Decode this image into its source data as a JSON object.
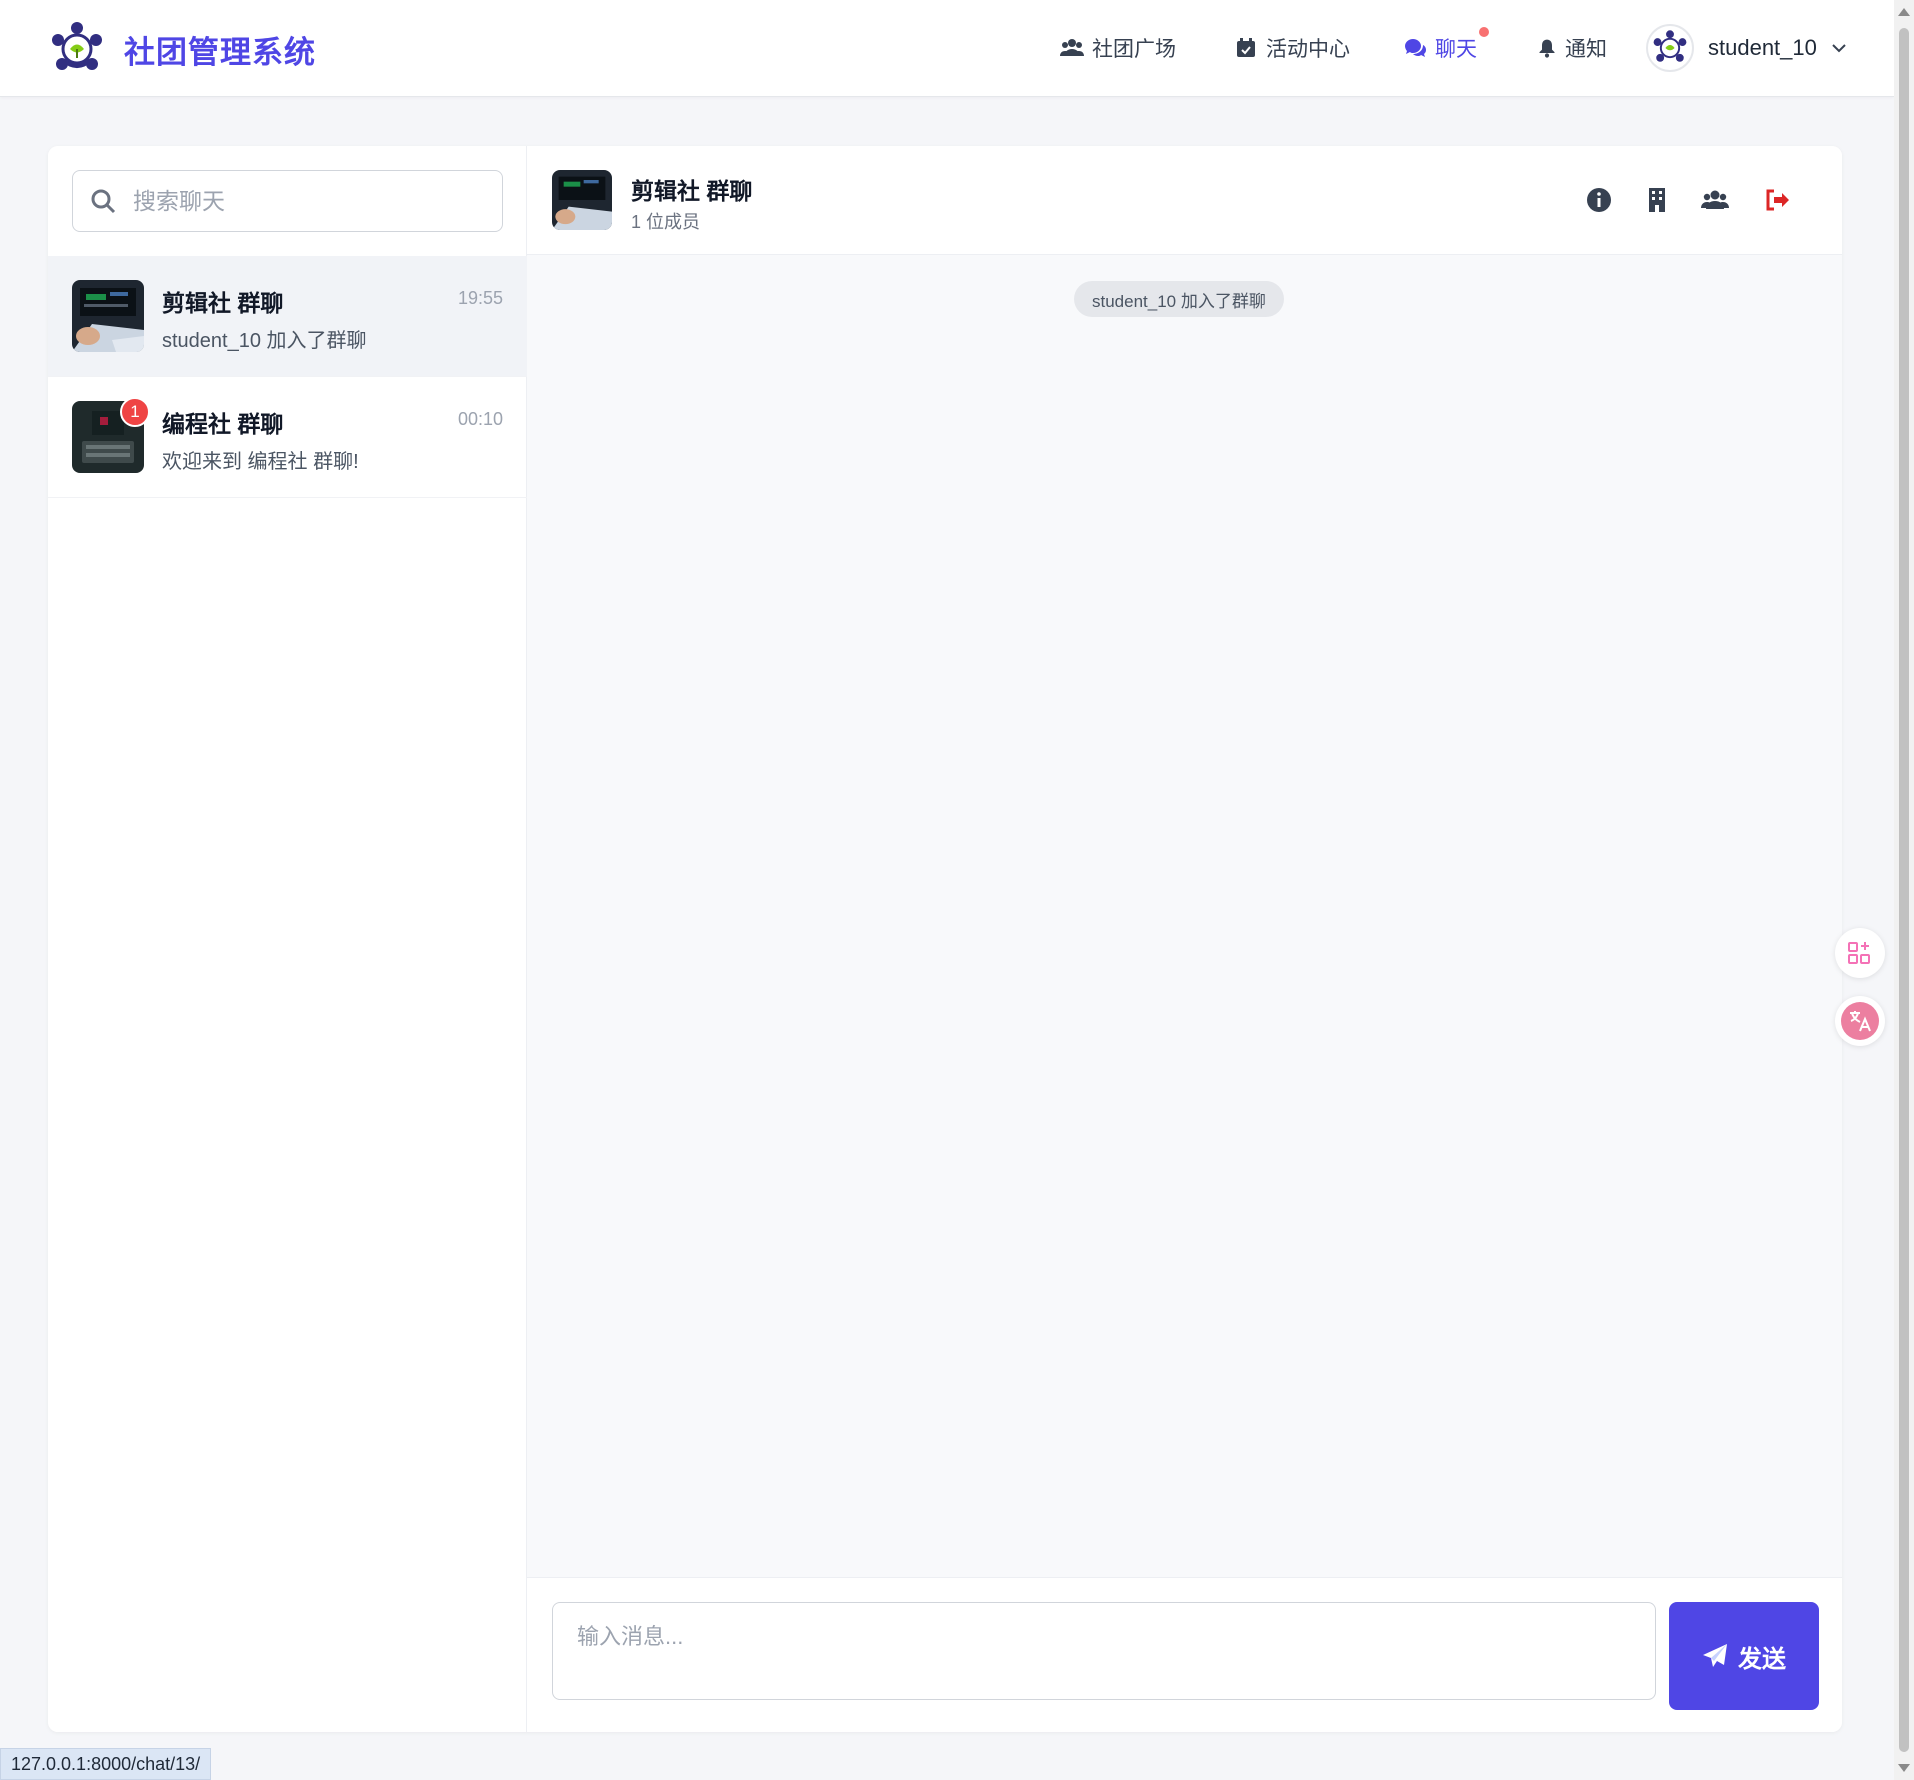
{
  "app": {
    "title": "社团管理系统",
    "logo_icon": "club-logo-icon"
  },
  "nav": {
    "items": [
      {
        "label": "社团广场",
        "icon": "users-icon"
      },
      {
        "label": "活动中心",
        "icon": "calendar-check-icon"
      },
      {
        "label": "聊天",
        "icon": "comments-icon",
        "active": true,
        "has_dot": true
      },
      {
        "label": "通知",
        "icon": "bell-icon"
      }
    ],
    "user": {
      "name": "student_10",
      "icon": "chevron-down-icon"
    }
  },
  "sidebar": {
    "search_placeholder": "搜索聊天",
    "chats": [
      {
        "name": "剪辑社 群聊",
        "time": "19:55",
        "last_message": "student_10 加入了群聊",
        "selected": true
      },
      {
        "name": "编程社 群聊",
        "time": "00:10",
        "last_message": "欢迎来到 编程社 群聊!",
        "unread": "1"
      }
    ]
  },
  "chat": {
    "title": "剪辑社 群聊",
    "subtitle": "1 位成员",
    "actions": [
      "info-icon",
      "building-icon",
      "members-icon",
      "leave-icon"
    ],
    "system_messages": [
      "student_10 加入了群聊"
    ],
    "input_placeholder": "输入消息...",
    "send_label": "发送"
  },
  "status_bar": {
    "url": "127.0.0.1:8000/chat/13/"
  },
  "colors": {
    "accent": "#4f46e5",
    "danger": "#ef4444",
    "leave": "#dc2626"
  }
}
